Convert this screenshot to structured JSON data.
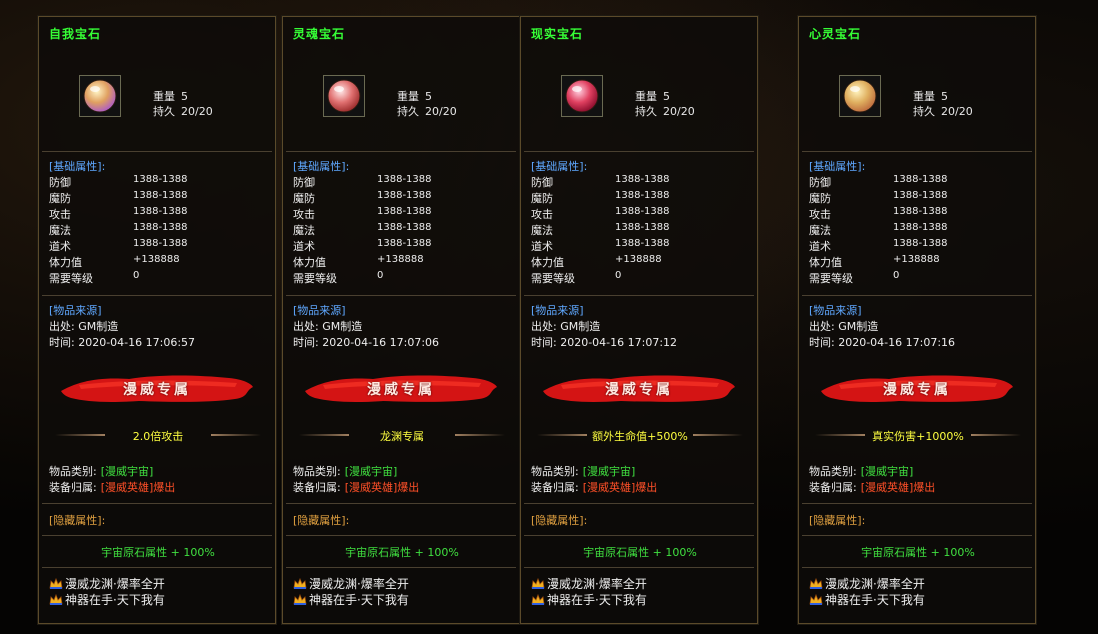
{
  "panels": [
    {
      "title": "自我宝石",
      "weight_label": "重量",
      "weight_value": "5",
      "durability_label": "持久",
      "durability_value": "20/20",
      "gem_colors": [
        "#fff6c8",
        "#e0a060",
        "#b060c0"
      ],
      "basic_header": "[基础属性]:",
      "attrs": [
        {
          "k": "防御",
          "v": "1388-1388"
        },
        {
          "k": "魔防",
          "v": "1388-1388"
        },
        {
          "k": "攻击",
          "v": "1388-1388"
        },
        {
          "k": "魔法",
          "v": "1388-1388"
        },
        {
          "k": "道术",
          "v": "1388-1388"
        },
        {
          "k": "体力值",
          "v": "+138888"
        },
        {
          "k": "需要等级",
          "v": "0"
        }
      ],
      "source_header": "[物品来源]",
      "origin": "出处: GM制造",
      "time": "时间: 2020-04-16 17:06:57",
      "banner": "漫威专属",
      "feature": "2.0倍攻击",
      "category_label": "物品类别:",
      "category_value": "[漫威宇宙]",
      "belong_label": "装备归属:",
      "belong_value": "[漫威英雄]爆出",
      "hidden_header": "[隐藏属性]:",
      "hidden_value": "宇宙原石属性 + 100%",
      "footer1": "漫威龙渊·爆率全开",
      "footer2": "神器在手·天下我有"
    },
    {
      "title": "灵魂宝石",
      "weight_label": "重量",
      "weight_value": "5",
      "durability_label": "持久",
      "durability_value": "20/20",
      "gem_colors": [
        "#ffe8e8",
        "#e07070",
        "#a03030"
      ],
      "basic_header": "[基础属性]:",
      "attrs": [
        {
          "k": "防御",
          "v": "1388-1388"
        },
        {
          "k": "魔防",
          "v": "1388-1388"
        },
        {
          "k": "攻击",
          "v": "1388-1388"
        },
        {
          "k": "魔法",
          "v": "1388-1388"
        },
        {
          "k": "道术",
          "v": "1388-1388"
        },
        {
          "k": "体力值",
          "v": "+138888"
        },
        {
          "k": "需要等级",
          "v": "0"
        }
      ],
      "source_header": "[物品来源]",
      "origin": "出处: GM制造",
      "time": "时间: 2020-04-16 17:07:06",
      "banner": "漫威专属",
      "feature": "龙渊专属",
      "category_label": "物品类别:",
      "category_value": "[漫威宇宙]",
      "belong_label": "装备归属:",
      "belong_value": "[漫威英雄]爆出",
      "hidden_header": "[隐藏属性]:",
      "hidden_value": "宇宙原石属性 + 100%",
      "footer1": "漫威龙渊·爆率全开",
      "footer2": "神器在手·天下我有"
    },
    {
      "title": "现实宝石",
      "weight_label": "重量",
      "weight_value": "5",
      "durability_label": "持久",
      "durability_value": "20/20",
      "gem_colors": [
        "#ffd0e0",
        "#e04060",
        "#901030"
      ],
      "basic_header": "[基础属性]:",
      "attrs": [
        {
          "k": "防御",
          "v": "1388-1388"
        },
        {
          "k": "魔防",
          "v": "1388-1388"
        },
        {
          "k": "攻击",
          "v": "1388-1388"
        },
        {
          "k": "魔法",
          "v": "1388-1388"
        },
        {
          "k": "道术",
          "v": "1388-1388"
        },
        {
          "k": "体力值",
          "v": "+138888"
        },
        {
          "k": "需要等级",
          "v": "0"
        }
      ],
      "source_header": "[物品来源]",
      "origin": "出处: GM制造",
      "time": "时间: 2020-04-16 17:07:12",
      "banner": "漫威专属",
      "feature": "额外生命值+500%",
      "category_label": "物品类别:",
      "category_value": "[漫威宇宙]",
      "belong_label": "装备归属:",
      "belong_value": "[漫威英雄]爆出",
      "hidden_header": "[隐藏属性]:",
      "hidden_value": "宇宙原石属性 + 100%",
      "footer1": "漫威龙渊·爆率全开",
      "footer2": "神器在手·天下我有"
    },
    {
      "title": "心灵宝石",
      "weight_label": "重量",
      "weight_value": "5",
      "durability_label": "持久",
      "durability_value": "20/20",
      "gem_colors": [
        "#fff4c0",
        "#e0b060",
        "#c07040"
      ],
      "basic_header": "[基础属性]:",
      "attrs": [
        {
          "k": "防御",
          "v": "1388-1388"
        },
        {
          "k": "魔防",
          "v": "1388-1388"
        },
        {
          "k": "攻击",
          "v": "1388-1388"
        },
        {
          "k": "魔法",
          "v": "1388-1388"
        },
        {
          "k": "道术",
          "v": "1388-1388"
        },
        {
          "k": "体力值",
          "v": "+138888"
        },
        {
          "k": "需要等级",
          "v": "0"
        }
      ],
      "source_header": "[物品来源]",
      "origin": "出处: GM制造",
      "time": "时间: 2020-04-16 17:07:16",
      "banner": "漫威专属",
      "feature": "真实伤害+1000%",
      "category_label": "物品类别:",
      "category_value": "[漫威宇宙]",
      "belong_label": "装备归属:",
      "belong_value": "[漫威英雄]爆出",
      "hidden_header": "[隐藏属性]:",
      "hidden_value": "宇宙原石属性 + 100%",
      "footer1": "漫威龙渊·爆率全开",
      "footer2": "神器在手·天下我有"
    }
  ]
}
